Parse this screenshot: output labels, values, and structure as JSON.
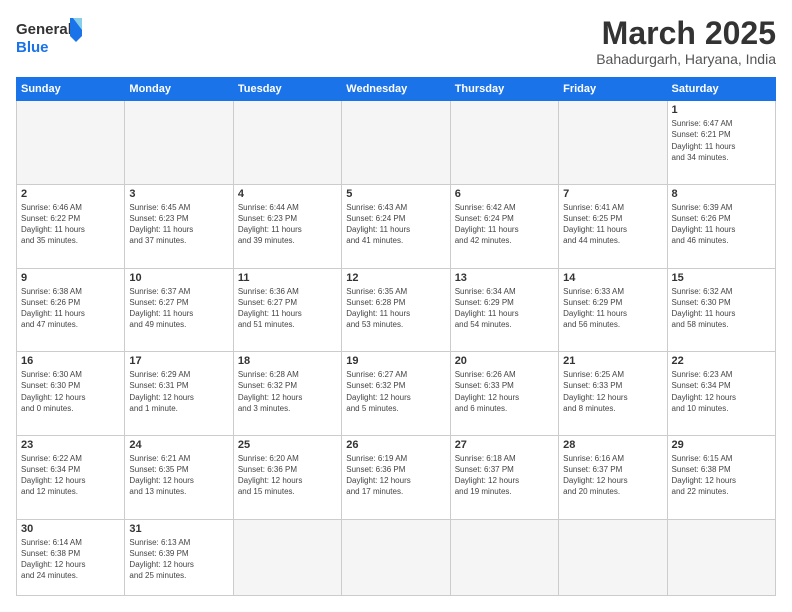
{
  "header": {
    "logo_general": "General",
    "logo_blue": "Blue",
    "month_title": "March 2025",
    "location": "Bahadurgarh, Haryana, India"
  },
  "weekdays": [
    "Sunday",
    "Monday",
    "Tuesday",
    "Wednesday",
    "Thursday",
    "Friday",
    "Saturday"
  ],
  "weeks": [
    [
      {
        "day": "",
        "info": ""
      },
      {
        "day": "",
        "info": ""
      },
      {
        "day": "",
        "info": ""
      },
      {
        "day": "",
        "info": ""
      },
      {
        "day": "",
        "info": ""
      },
      {
        "day": "",
        "info": ""
      },
      {
        "day": "1",
        "info": "Sunrise: 6:47 AM\nSunset: 6:21 PM\nDaylight: 11 hours\nand 34 minutes."
      }
    ],
    [
      {
        "day": "2",
        "info": "Sunrise: 6:46 AM\nSunset: 6:22 PM\nDaylight: 11 hours\nand 35 minutes."
      },
      {
        "day": "3",
        "info": "Sunrise: 6:45 AM\nSunset: 6:23 PM\nDaylight: 11 hours\nand 37 minutes."
      },
      {
        "day": "4",
        "info": "Sunrise: 6:44 AM\nSunset: 6:23 PM\nDaylight: 11 hours\nand 39 minutes."
      },
      {
        "day": "5",
        "info": "Sunrise: 6:43 AM\nSunset: 6:24 PM\nDaylight: 11 hours\nand 41 minutes."
      },
      {
        "day": "6",
        "info": "Sunrise: 6:42 AM\nSunset: 6:24 PM\nDaylight: 11 hours\nand 42 minutes."
      },
      {
        "day": "7",
        "info": "Sunrise: 6:41 AM\nSunset: 6:25 PM\nDaylight: 11 hours\nand 44 minutes."
      },
      {
        "day": "8",
        "info": "Sunrise: 6:39 AM\nSunset: 6:26 PM\nDaylight: 11 hours\nand 46 minutes."
      }
    ],
    [
      {
        "day": "9",
        "info": "Sunrise: 6:38 AM\nSunset: 6:26 PM\nDaylight: 11 hours\nand 47 minutes."
      },
      {
        "day": "10",
        "info": "Sunrise: 6:37 AM\nSunset: 6:27 PM\nDaylight: 11 hours\nand 49 minutes."
      },
      {
        "day": "11",
        "info": "Sunrise: 6:36 AM\nSunset: 6:27 PM\nDaylight: 11 hours\nand 51 minutes."
      },
      {
        "day": "12",
        "info": "Sunrise: 6:35 AM\nSunset: 6:28 PM\nDaylight: 11 hours\nand 53 minutes."
      },
      {
        "day": "13",
        "info": "Sunrise: 6:34 AM\nSunset: 6:29 PM\nDaylight: 11 hours\nand 54 minutes."
      },
      {
        "day": "14",
        "info": "Sunrise: 6:33 AM\nSunset: 6:29 PM\nDaylight: 11 hours\nand 56 minutes."
      },
      {
        "day": "15",
        "info": "Sunrise: 6:32 AM\nSunset: 6:30 PM\nDaylight: 11 hours\nand 58 minutes."
      }
    ],
    [
      {
        "day": "16",
        "info": "Sunrise: 6:30 AM\nSunset: 6:30 PM\nDaylight: 12 hours\nand 0 minutes."
      },
      {
        "day": "17",
        "info": "Sunrise: 6:29 AM\nSunset: 6:31 PM\nDaylight: 12 hours\nand 1 minute."
      },
      {
        "day": "18",
        "info": "Sunrise: 6:28 AM\nSunset: 6:32 PM\nDaylight: 12 hours\nand 3 minutes."
      },
      {
        "day": "19",
        "info": "Sunrise: 6:27 AM\nSunset: 6:32 PM\nDaylight: 12 hours\nand 5 minutes."
      },
      {
        "day": "20",
        "info": "Sunrise: 6:26 AM\nSunset: 6:33 PM\nDaylight: 12 hours\nand 6 minutes."
      },
      {
        "day": "21",
        "info": "Sunrise: 6:25 AM\nSunset: 6:33 PM\nDaylight: 12 hours\nand 8 minutes."
      },
      {
        "day": "22",
        "info": "Sunrise: 6:23 AM\nSunset: 6:34 PM\nDaylight: 12 hours\nand 10 minutes."
      }
    ],
    [
      {
        "day": "23",
        "info": "Sunrise: 6:22 AM\nSunset: 6:34 PM\nDaylight: 12 hours\nand 12 minutes."
      },
      {
        "day": "24",
        "info": "Sunrise: 6:21 AM\nSunset: 6:35 PM\nDaylight: 12 hours\nand 13 minutes."
      },
      {
        "day": "25",
        "info": "Sunrise: 6:20 AM\nSunset: 6:36 PM\nDaylight: 12 hours\nand 15 minutes."
      },
      {
        "day": "26",
        "info": "Sunrise: 6:19 AM\nSunset: 6:36 PM\nDaylight: 12 hours\nand 17 minutes."
      },
      {
        "day": "27",
        "info": "Sunrise: 6:18 AM\nSunset: 6:37 PM\nDaylight: 12 hours\nand 19 minutes."
      },
      {
        "day": "28",
        "info": "Sunrise: 6:16 AM\nSunset: 6:37 PM\nDaylight: 12 hours\nand 20 minutes."
      },
      {
        "day": "29",
        "info": "Sunrise: 6:15 AM\nSunset: 6:38 PM\nDaylight: 12 hours\nand 22 minutes."
      }
    ],
    [
      {
        "day": "30",
        "info": "Sunrise: 6:14 AM\nSunset: 6:38 PM\nDaylight: 12 hours\nand 24 minutes."
      },
      {
        "day": "31",
        "info": "Sunrise: 6:13 AM\nSunset: 6:39 PM\nDaylight: 12 hours\nand 25 minutes."
      },
      {
        "day": "",
        "info": ""
      },
      {
        "day": "",
        "info": ""
      },
      {
        "day": "",
        "info": ""
      },
      {
        "day": "",
        "info": ""
      },
      {
        "day": "",
        "info": ""
      }
    ]
  ]
}
